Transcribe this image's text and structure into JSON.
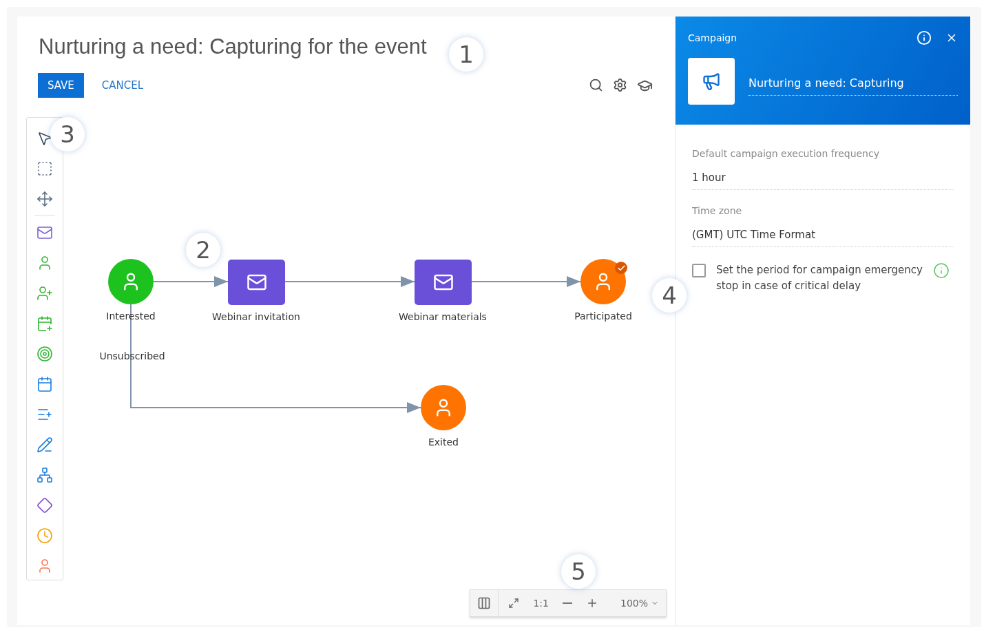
{
  "title": "Nurturing a need: Capturing for the event",
  "actions": {
    "save": "SAVE",
    "cancel": "CANCEL"
  },
  "nodes": [
    {
      "kind": "contact",
      "label": "Interested",
      "color": "#1ec21e",
      "completed": false,
      "branch_label": "Unsubscribed"
    },
    {
      "kind": "email",
      "label": "Webinar invitation",
      "color": "#6a4fd8",
      "completed": false
    },
    {
      "kind": "email",
      "label": "Webinar materials",
      "color": "#6a4fd8",
      "completed": false
    },
    {
      "kind": "contact",
      "label": "Participated",
      "color": "#ff7300",
      "completed": true
    },
    {
      "kind": "contact",
      "label": "Exited",
      "color": "#ff7300",
      "completed": false
    }
  ],
  "zoom": {
    "ratio": "1:1",
    "value": "100%"
  },
  "callouts": [
    "1",
    "2",
    "3",
    "4",
    "5"
  ],
  "panel": {
    "caption": "Campaign",
    "name": "Nurturing a need: Capturing",
    "fields": [
      {
        "label": "Default campaign execution frequency",
        "value": "1 hour"
      },
      {
        "label": "Time zone",
        "value": "(GMT) UTC Time Format"
      }
    ],
    "option": {
      "label": "Set the period for campaign emergency stop in case of critical delay",
      "checked": false
    }
  }
}
